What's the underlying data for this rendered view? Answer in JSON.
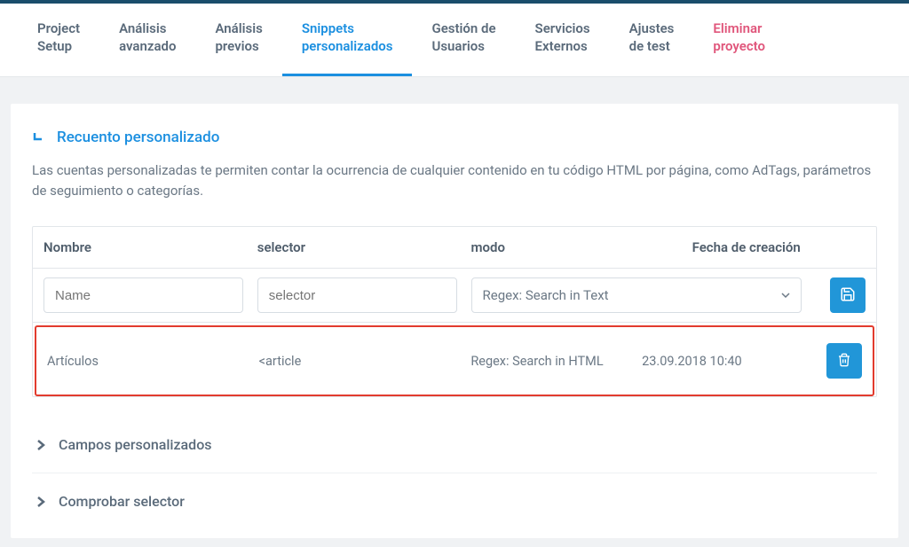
{
  "tabs": [
    {
      "line1": "Project",
      "line2": "Setup"
    },
    {
      "line1": "Análisis",
      "line2": "avanzado"
    },
    {
      "line1": "Análisis",
      "line2": "previos"
    },
    {
      "line1": "Snippets",
      "line2": "personalizados"
    },
    {
      "line1": "Gestión de",
      "line2": "Usuarios"
    },
    {
      "line1": "Servicios",
      "line2": "Externos"
    },
    {
      "line1": "Ajustes",
      "line2": "de test"
    },
    {
      "line1": "Eliminar",
      "line2": "proyecto"
    }
  ],
  "section": {
    "title": "Recuento personalizado",
    "description": "Las cuentas personalizadas te permiten contar la ocurrencia de cualquier contenido en tu código HTML por página, como AdTags, parámetros de seguimiento o categorías."
  },
  "columns": {
    "name": "Nombre",
    "selector": "selector",
    "mode": "modo",
    "created": "Fecha de creación"
  },
  "inputs": {
    "name_placeholder": "Name",
    "selector_placeholder": "selector",
    "mode_selected": "Regex: Search in Text"
  },
  "row": {
    "name": "Artículos",
    "selector": "<article",
    "mode": "Regex: Search in HTML",
    "created": "23.09.2018 10:40"
  },
  "accordions": {
    "custom_fields": "Campos personalizados",
    "check_selector": "Comprobar selector"
  }
}
